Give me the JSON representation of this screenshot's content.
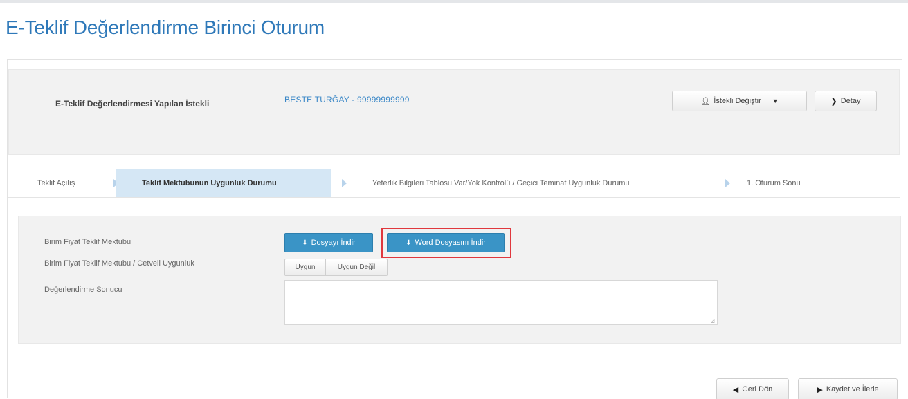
{
  "page": {
    "title": "E-Teklif Değerlendirme Birinci Oturum"
  },
  "header": {
    "bidder_label": "E-Teklif Değerlendirmesi Yapılan İstekli",
    "bidder_value": "BESTE TURĞAY - 99999999999",
    "change_button": "İstekli Değiştir",
    "detail_button": "Detay"
  },
  "steps": [
    {
      "label": "Teklif Açılış",
      "active": false
    },
    {
      "label": "Teklif Mektubunun Uygunluk Durumu",
      "active": true
    },
    {
      "label": "Yeterlik Bilgileri Tablosu Var/Yok Kontrolü / Geçici Teminat Uygunluk Durumu",
      "active": false
    },
    {
      "label": "1. Oturum Sonu",
      "active": false
    }
  ],
  "form": {
    "letter_label": "Birim Fiyat Teklif Mektubu",
    "compliance_label": "Birim Fiyat Teklif Mektubu / Cetveli Uygunluk",
    "result_label": "Değerlendirme Sonucu",
    "download_button": "Dosyayı İndir",
    "word_download_button": "Word Dosyasını İndir",
    "compliant_button": "Uygun",
    "not_compliant_button": "Uygun Değil",
    "result_value": ""
  },
  "footer": {
    "back_button": "Geri Dön",
    "save_next_button": "Kaydet ve İlerle"
  },
  "icons": {
    "user": "user-icon",
    "chevron": "chevron-down-icon",
    "download": "download-icon",
    "back": "back-icon",
    "forward": "forward-icon"
  },
  "colors": {
    "title": "#2f79b9",
    "primary": "#3a94c6",
    "active_step": "#d5e7f5",
    "highlight": "#e0383e"
  }
}
